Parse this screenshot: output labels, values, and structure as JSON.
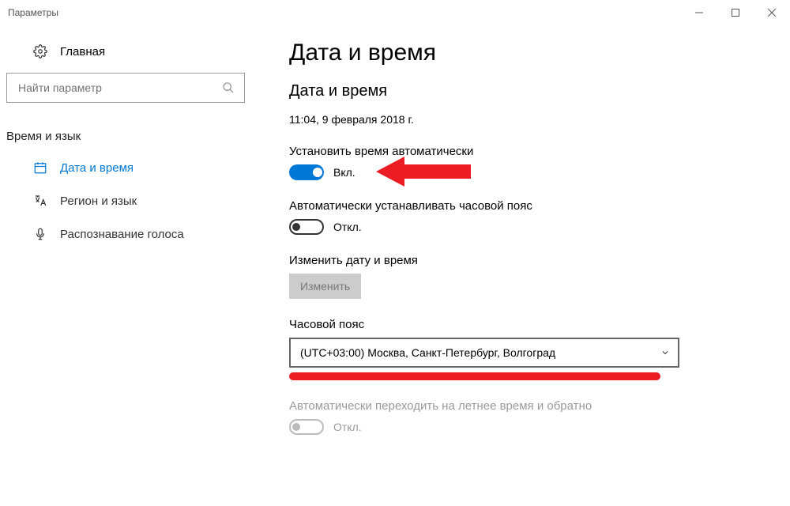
{
  "titlebar": {
    "title": "Параметры"
  },
  "sidebar": {
    "home_label": "Главная",
    "search_placeholder": "Найти параметр",
    "section_title": "Время и язык",
    "items": [
      {
        "label": "Дата и время"
      },
      {
        "label": "Регион и язык"
      },
      {
        "label": "Распознавание голоса"
      }
    ]
  },
  "content": {
    "page_title": "Дата и время",
    "section_title": "Дата и время",
    "current_datetime": "11:04, 9 февраля 2018 г.",
    "auto_time": {
      "label": "Установить время автоматически",
      "state_text": "Вкл.",
      "on": true
    },
    "auto_tz": {
      "label": "Автоматически устанавливать часовой пояс",
      "state_text": "Откл.",
      "on": false
    },
    "change_dt": {
      "label": "Изменить дату и время",
      "button": "Изменить"
    },
    "timezone": {
      "label": "Часовой пояс",
      "value": "(UTC+03:00) Москва, Санкт-Петербург, Волгоград"
    },
    "dst": {
      "label": "Автоматически переходить на летнее время и обратно",
      "state_text": "Откл.",
      "on": false,
      "disabled": true
    }
  },
  "annotations": {
    "arrow_color": "#ec1c24"
  }
}
